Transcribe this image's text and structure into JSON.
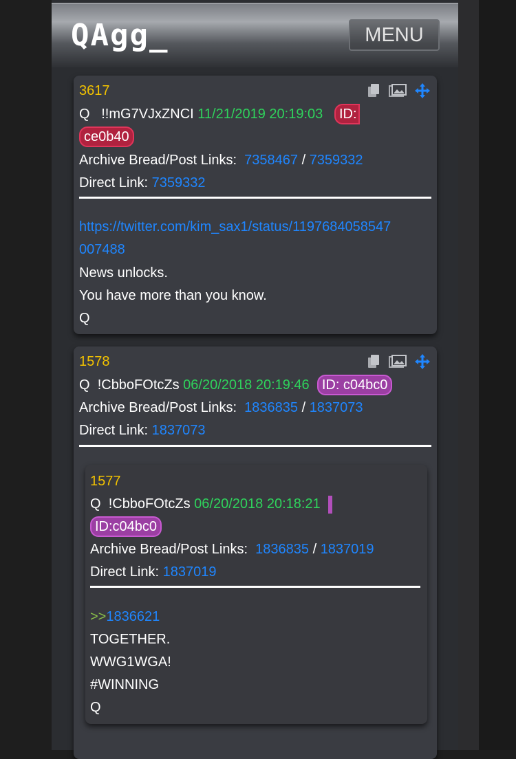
{
  "header": {
    "logo": "QAgg_",
    "menu_label": "MENU"
  },
  "posts": [
    {
      "number": "3617",
      "author": "Q",
      "trip": "!!mG7VJxZNCI",
      "datetime": "11/21/2019 20:19:03",
      "id_prefix": "ID:",
      "id_value": "ce0b40",
      "archive_label": "Archive Bread/Post Links:",
      "archive_link_1": "7358467",
      "separator": "/",
      "archive_link_2": "7359332",
      "direct_label": "Direct Link:",
      "direct_link": "7359332",
      "body_url_line1": "https://twitter.com/kim_sax1/status/1197684058547",
      "body_url_line2": "007488",
      "body_lines": [
        "News unlocks.",
        "You have more than you know.",
        "Q"
      ]
    },
    {
      "number": "1578",
      "author": "Q",
      "trip": "!CbboFOtcZs",
      "datetime": "06/20/2018 20:19:46",
      "id_badge": "ID: c04bc0",
      "archive_label": "Archive Bread/Post Links:",
      "archive_link_1": "1836835",
      "separator": "/",
      "archive_link_2": "1837073",
      "direct_label": "Direct Link:",
      "direct_link": "1837073"
    },
    {
      "number": "1577",
      "author": "Q",
      "trip": "!CbboFOtcZs",
      "datetime": "06/20/2018 20:18:21",
      "id_badge": "ID:c04bc0",
      "archive_label": "Archive Bread/Post Links:",
      "archive_link_1": "1836835",
      "separator": "/",
      "archive_link_2": "1837019",
      "direct_label": "Direct Link:",
      "direct_link": "1837019",
      "quote_prefix": ">>",
      "quote_link": "1836621",
      "body_lines": [
        "TOGETHER.",
        "WWG1WGA!",
        "#WINNING",
        "Q"
      ]
    }
  ],
  "icons": [
    "copy-icon",
    "image-icon",
    "move-icon"
  ],
  "colors": {
    "post_number": "#f2c200",
    "date": "#2fd35c",
    "link": "#1f86ff",
    "id_red": "#b0223f",
    "id_purple": "#9b3fa3",
    "quote_arrows": "#8bc34a"
  }
}
